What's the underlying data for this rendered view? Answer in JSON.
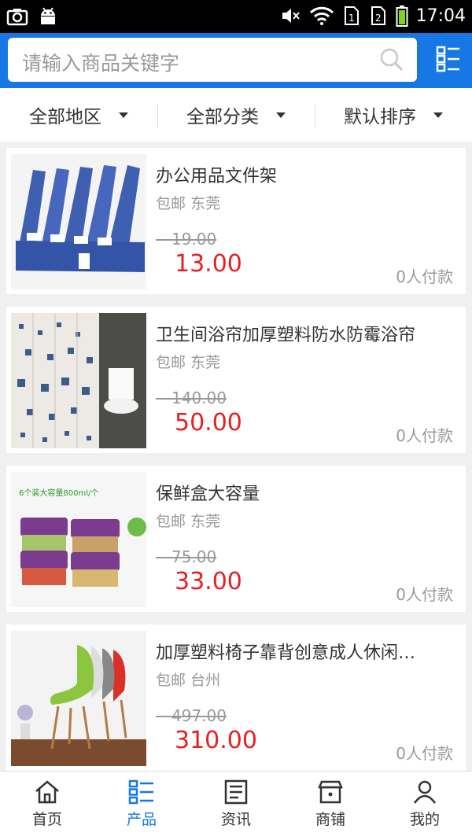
{
  "status_bar": {
    "time": "17:04"
  },
  "search": {
    "placeholder": "请输入商品关键字"
  },
  "filters": [
    {
      "label": "全部地区"
    },
    {
      "label": "全部分类"
    },
    {
      "label": "默认排序"
    }
  ],
  "products": [
    {
      "title": "办公用品文件架",
      "shipping": "包邮",
      "city": "东莞",
      "old_price": "19.00",
      "price": "13.00",
      "paid": "0人付款",
      "image": "file-rack-photo"
    },
    {
      "title": "卫生间浴帘加厚塑料防水防霉浴帘",
      "shipping": "包邮",
      "city": "东莞",
      "old_price": "140.00",
      "price": "50.00",
      "paid": "0人付款",
      "image": "shower-curtain-photo"
    },
    {
      "title": "保鲜盒大容量",
      "shipping": "包邮",
      "city": "东莞",
      "old_price": "75.00",
      "price": "33.00",
      "paid": "0人付款",
      "image": "food-containers-photo",
      "image_caption": "6个装大容量800ml/个"
    },
    {
      "title": "加厚塑料椅子靠背创意成人休闲…",
      "shipping": "包邮",
      "city": "台州",
      "old_price": "497.00",
      "price": "310.00",
      "paid": "0人付款",
      "image": "chairs-photo"
    }
  ],
  "tabs": [
    {
      "label": "首页",
      "icon": "home-icon"
    },
    {
      "label": "产品",
      "icon": "products-icon",
      "active": true
    },
    {
      "label": "资讯",
      "icon": "news-icon"
    },
    {
      "label": "商铺",
      "icon": "shop-icon"
    },
    {
      "label": "我的",
      "icon": "profile-icon"
    }
  ],
  "colors": {
    "accent": "#1677e5",
    "price": "#e81f1f"
  }
}
